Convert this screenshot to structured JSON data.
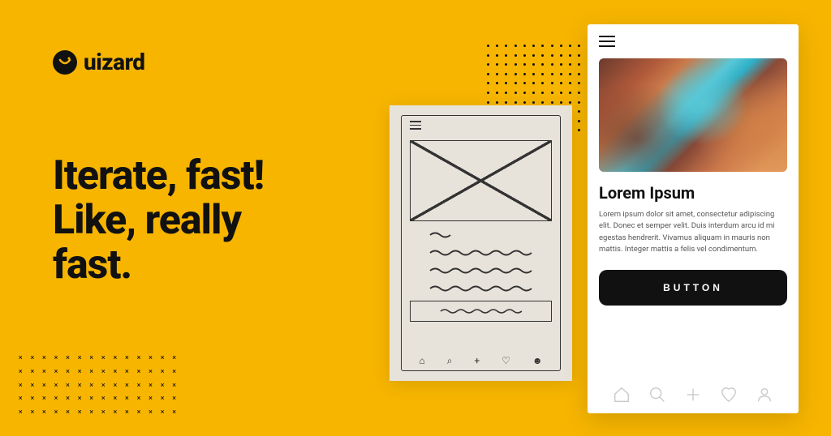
{
  "logo": {
    "text": "uizard"
  },
  "headline": "Iterate, fast!\nLike, really\nfast.",
  "phone": {
    "title": "Lorem Ipsum",
    "body": "Lorem ipsum dolor sit amet, consectetur adipiscing elit. Donec et semper velit. Duis interdum arcu id mi egestas hendrerit. Vivamus aliquam in mauris non mattis. Integer mattis a felis vel condimentum.",
    "button_label": "BUTTON"
  }
}
